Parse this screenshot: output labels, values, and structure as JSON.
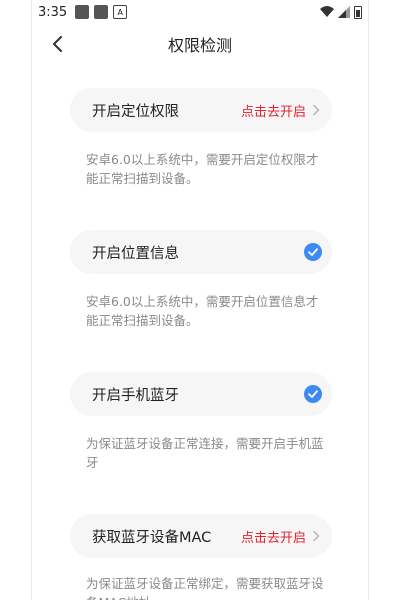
{
  "status_bar": {
    "time": "3:35",
    "a_label": "A"
  },
  "nav": {
    "title": "权限检测"
  },
  "permissions": [
    {
      "label": "开启定位权限",
      "action": "点击去开启",
      "desc": "安卓6.0以上系统中，需要开启定位权限才能正常扫描到设备。"
    },
    {
      "label": "开启位置信息",
      "desc": "安卓6.0以上系统中，需要开启位置信息才能正常扫描到设备。"
    },
    {
      "label": "开启手机蓝牙",
      "desc": "为保证蓝牙设备正常连接，需要开启手机蓝牙"
    },
    {
      "label": "获取蓝牙设备MAC",
      "action": "点击去开启",
      "desc": "为保证蓝牙设备正常绑定，需要获取蓝牙设备MAC地址"
    }
  ],
  "colors": {
    "accent_red": "#e2232e",
    "check_blue": "#3d8bf2",
    "card_bg": "#f6f6f7"
  },
  "icons": {
    "back": "chevron-left-icon",
    "go": "chevron-right-icon",
    "done": "check-circle-icon"
  }
}
